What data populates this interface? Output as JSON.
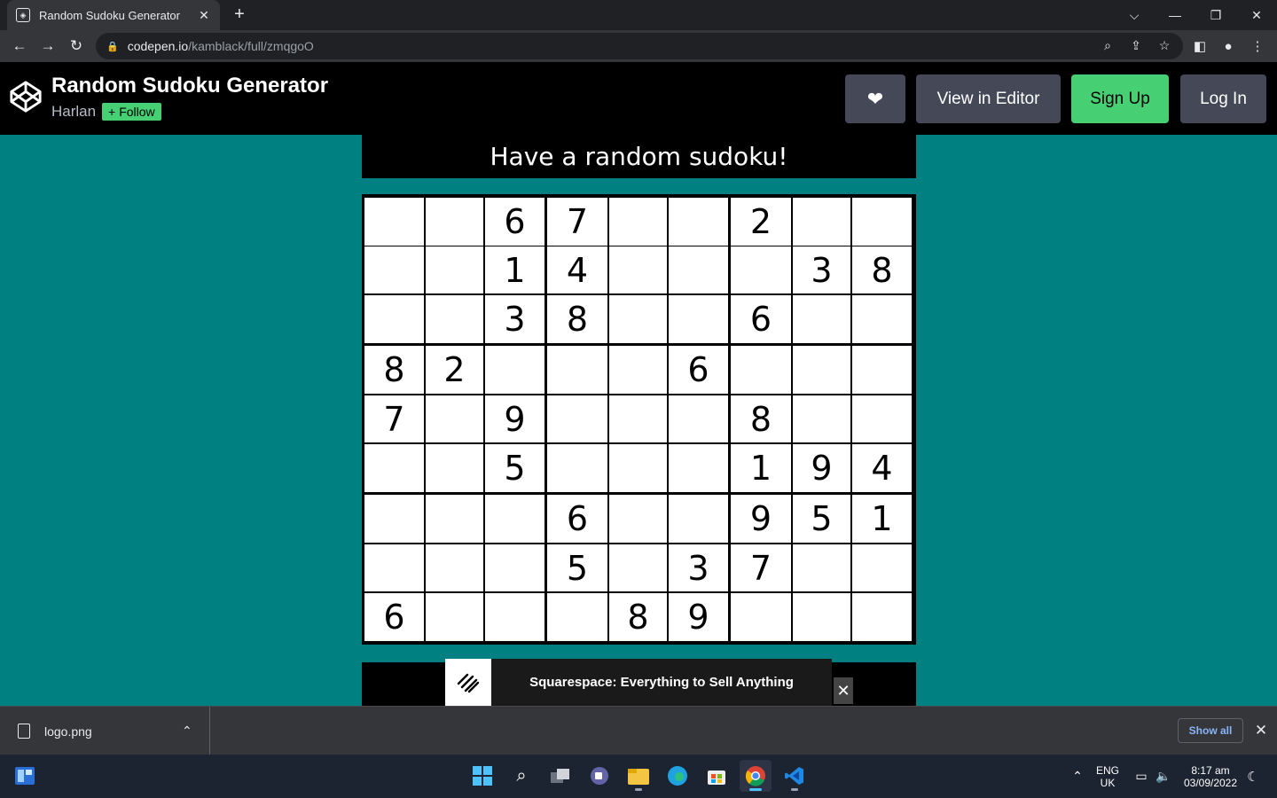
{
  "browser": {
    "tab_title": "Random Sudoku Generator",
    "tab_close": "✕",
    "new_tab": "+",
    "url_host": "codepen.io",
    "url_path": "/kamblack/full/zmqgoO"
  },
  "codepen": {
    "title": "Random Sudoku Generator",
    "author": "Harlan",
    "follow_label": "Follow",
    "heart_label": "❤",
    "view_in_editor": "View in Editor",
    "sign_up": "Sign Up",
    "log_in": "Log In"
  },
  "page": {
    "banner": "Have a random sudoku!"
  },
  "sudoku": {
    "grid": [
      [
        "",
        "",
        "6",
        "7",
        "",
        "",
        "2",
        "",
        ""
      ],
      [
        "",
        "",
        "1",
        "4",
        "",
        "",
        "",
        "3",
        "8"
      ],
      [
        "",
        "",
        "3",
        "8",
        "",
        "",
        "6",
        "",
        ""
      ],
      [
        "8",
        "2",
        "",
        "",
        "",
        "6",
        "",
        "",
        ""
      ],
      [
        "7",
        "",
        "9",
        "",
        "",
        "",
        "8",
        "",
        ""
      ],
      [
        "",
        "",
        "5",
        "",
        "",
        "",
        "1",
        "9",
        "4"
      ],
      [
        "",
        "",
        "",
        "6",
        "",
        "",
        "9",
        "5",
        "1"
      ],
      [
        "",
        "",
        "",
        "5",
        "",
        "3",
        "7",
        "",
        ""
      ],
      [
        "6",
        "",
        "",
        "",
        "8",
        "9",
        "",
        "",
        ""
      ]
    ]
  },
  "ad": {
    "text": "Squarespace: Everything to Sell Anything",
    "close": "✕"
  },
  "downloads": {
    "file_name": "logo.png",
    "show_all": "Show all",
    "close": "✕"
  },
  "taskbar": {
    "lang_1": "ENG",
    "lang_2": "UK",
    "time": "8:17 am",
    "date": "03/09/2022"
  },
  "colors": {
    "page_bg": "#008080",
    "codepen_green": "#47cf73",
    "codepen_button": "#444857"
  }
}
